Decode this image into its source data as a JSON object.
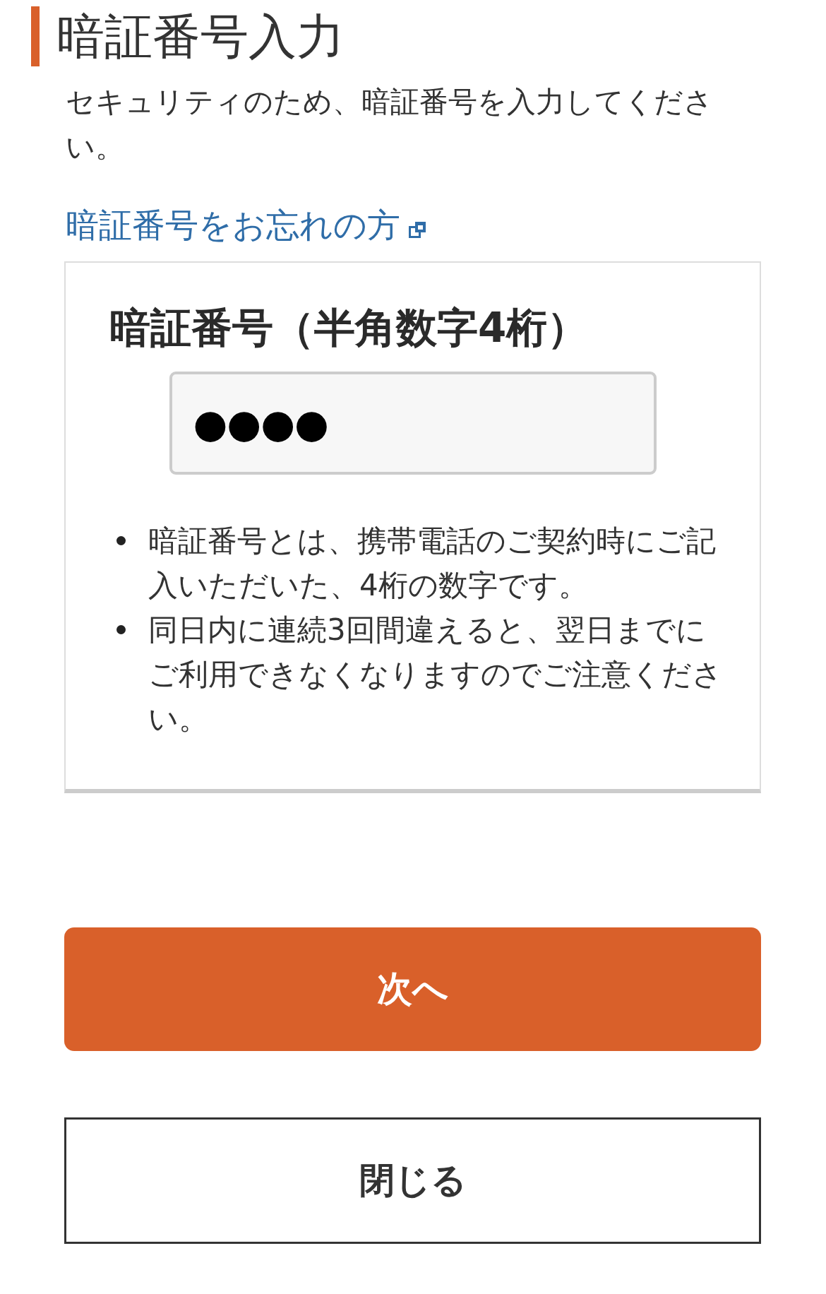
{
  "header": {
    "title": "暗証番号入力",
    "description": "セキュリティのため、暗証番号を入力してください。",
    "forgot_link": "暗証番号をお忘れの方"
  },
  "pin_form": {
    "label": "暗証番号（半角数字4桁）",
    "value": "●●●●",
    "notes": [
      "暗証番号とは、携帯電話のご契約時にご記入いただいた、4桁の数字です。",
      "同日内に連続3回間違えると、翌日までにご利用できなくなりますのでご注意ください。"
    ]
  },
  "buttons": [
    {
      "label": "次へ",
      "kind": "primary"
    },
    {
      "label": "閉じる",
      "kind": "secondary"
    }
  ]
}
